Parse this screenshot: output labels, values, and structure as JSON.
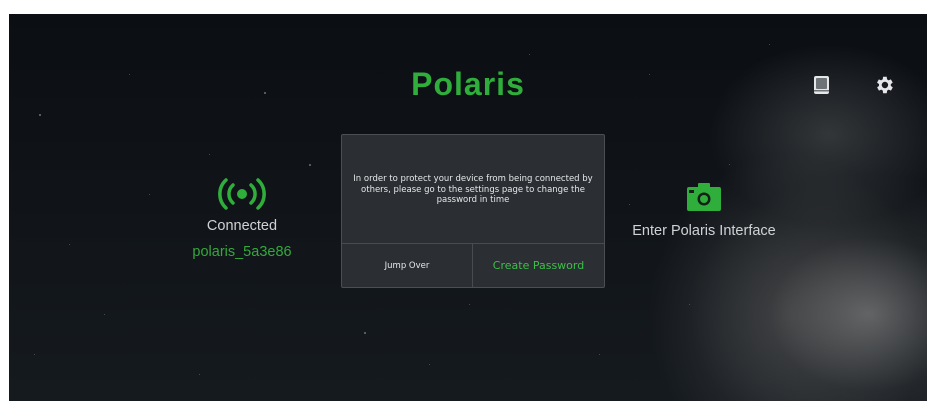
{
  "app": {
    "title": "Polaris"
  },
  "toolbar": {
    "book_icon": "book-icon",
    "settings_icon": "gear-icon"
  },
  "connection": {
    "icon": "wifi-signal-icon",
    "status": "Connected",
    "ssid": "polaris_5a3e86"
  },
  "interface_link": {
    "icon": "camera-icon",
    "label": "Enter Polaris Interface"
  },
  "dialog": {
    "message": "In order to protect your device from being connected by others, please go to the settings page to change the password in time",
    "jump_over_label": "Jump Over",
    "create_password_label": "Create Password"
  },
  "colors": {
    "accent_green": "#2fae3b",
    "dialog_bg": "#2b2f33",
    "text_light": "#cfd3d6"
  }
}
